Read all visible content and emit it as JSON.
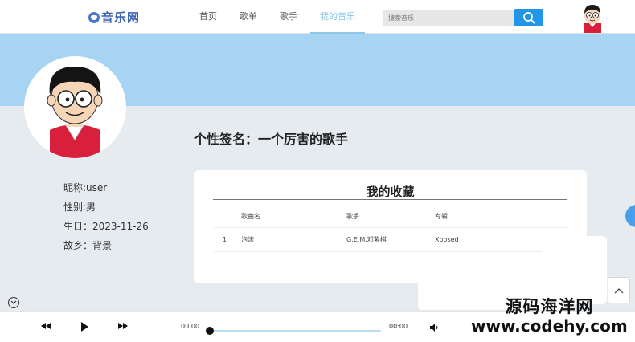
{
  "brand": {
    "name": "音乐网"
  },
  "nav": {
    "items": [
      "首页",
      "歌单",
      "歌手",
      "我的音乐"
    ],
    "active_index": 3
  },
  "search": {
    "placeholder": "搜索音乐",
    "value": ""
  },
  "profile": {
    "signature": "个性签名：一个厉害的歌手",
    "nickname": "昵称:user",
    "gender": "性别:男",
    "birthday": "生日：2023-11-26",
    "hometown": "故乡：背景"
  },
  "favorites": {
    "title": "我的收藏",
    "columns": [
      "",
      "歌曲名",
      "歌手",
      "专辑"
    ],
    "rows": [
      {
        "index": "1",
        "song": "泡沫",
        "singer": "G.E.M.邓紫棋",
        "album": "Xposed"
      }
    ]
  },
  "player": {
    "current_time": "00:00",
    "total_time": "00:00",
    "progress": 0
  },
  "watermark": {
    "line1": "源码海洋网",
    "line2": "www.codehy.com"
  },
  "colors": {
    "accent": "#2196e8",
    "banner": "#a6d4f2",
    "nav_active": "#8ec6e6",
    "background": "#e6ebf0"
  },
  "icons": {
    "logo": "doraemon-icon",
    "search": "search-icon",
    "prev": "previous-track-icon",
    "play": "play-icon",
    "next": "next-track-icon",
    "volume": "volume-icon",
    "back_to_top": "chevron-up-icon",
    "collapse": "chevron-down-icon"
  }
}
